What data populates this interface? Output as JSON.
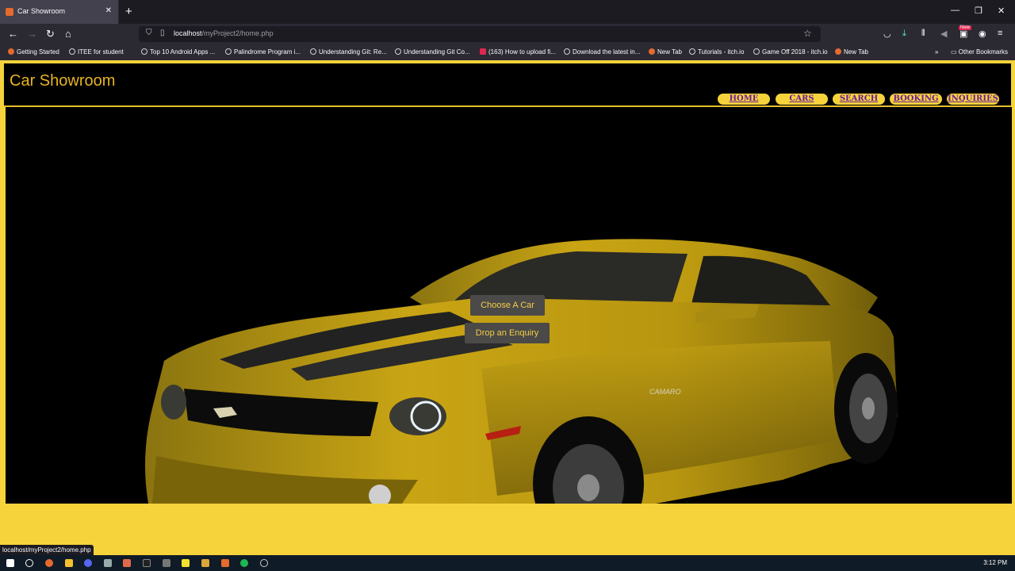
{
  "browser": {
    "tab_title": "Car Showroom",
    "url_host": "localhost",
    "url_path": "/myProject2/home.php",
    "new_badge": "New",
    "status_url": "localhost/myProject2/home.php"
  },
  "bookmarks": [
    {
      "label": "Getting Started",
      "icon": "firefox"
    },
    {
      "label": "ITEE for student",
      "icon": "globe"
    },
    {
      "label": "Top 10 Android Apps ...",
      "icon": "globe"
    },
    {
      "label": "Palindrome Program i...",
      "icon": "globe"
    },
    {
      "label": "Understanding Git: Re...",
      "icon": "globe"
    },
    {
      "label": "Understanding Git Co...",
      "icon": "globe"
    },
    {
      "label": "(163) How to upload fi...",
      "icon": "youtube"
    },
    {
      "label": "Download the latest in...",
      "icon": "globe"
    },
    {
      "label": "New Tab",
      "icon": "firefox"
    },
    {
      "label": "Tutorials - itch.io",
      "icon": "globe"
    },
    {
      "label": "Game Off 2018 - itch.io",
      "icon": "globe"
    },
    {
      "label": "New Tab",
      "icon": "firefox"
    }
  ],
  "other_bookmarks": "Other Bookmarks",
  "site": {
    "title": "Car Showroom",
    "menu": [
      "HOME",
      "CARS",
      "SEARCH",
      "BOOKING",
      "INQUIRIES"
    ],
    "hero_buttons": [
      "Choose A Car",
      "Drop an Enquiry"
    ],
    "car_badge": "CAMARO"
  },
  "taskbar": {
    "clock": "3:12 PM"
  },
  "colors": {
    "page_bg": "#f6d33b",
    "title_gold": "#e6b423",
    "menu_text": "#6b1c9e",
    "car_yellow": "#c9a514"
  }
}
